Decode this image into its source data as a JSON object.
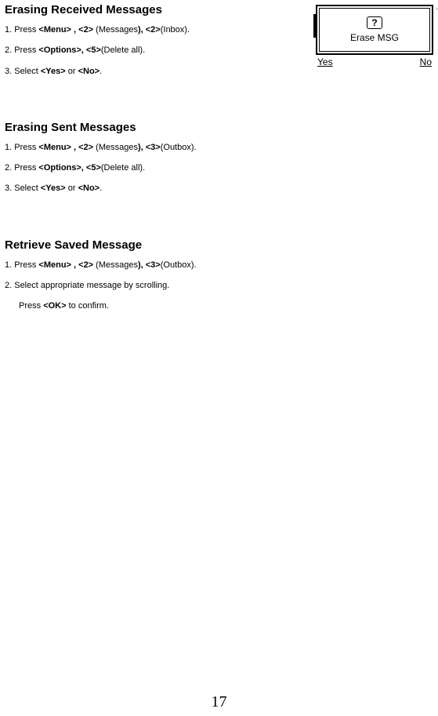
{
  "page_number": "17",
  "sections": [
    {
      "heading": "Erasing Received Messages",
      "steps": [
        {
          "prefix": "1. Press ",
          "b1": "<Menu> , <2>",
          "mid": " (Messages",
          "b2": "),  <2>",
          "suffix": "(Inbox)."
        },
        {
          "prefix": "2. Press ",
          "b1": "<Options>,  <5>",
          "mid": "",
          "b2": "",
          "suffix": "(Delete all)."
        },
        {
          "prefix": "3. Select ",
          "b1": "<Yes>",
          "mid": " or ",
          "b2": "<No>",
          "suffix": "."
        }
      ]
    },
    {
      "heading": "Erasing Sent Messages",
      "steps": [
        {
          "prefix": "1. Press ",
          "b1": "<Menu> , <2>",
          "mid": " (Messages",
          "b2": "), <3>",
          "suffix": "(Outbox)."
        },
        {
          "prefix": "2. Press ",
          "b1": "<Options>,  <5>",
          "mid": "",
          "b2": "",
          "suffix": "(Delete all)."
        },
        {
          "prefix": "3. Select ",
          "b1": "<Yes>",
          "mid": " or ",
          "b2": "<No>",
          "suffix": "."
        }
      ]
    },
    {
      "heading": "Retrieve Saved Message",
      "steps": [
        {
          "prefix": "1. Press ",
          "b1": "<Menu> , <2>",
          "mid": " (Messages",
          "b2": "), <3>",
          "suffix": "(Outbox)."
        },
        {
          "prefix": "2. Select appropriate message by scrolling.",
          "b1": "",
          "mid": "",
          "b2": "",
          "suffix": ""
        }
      ],
      "extra": {
        "prefix": "Press ",
        "b1": "<OK>",
        "suffix": " to confirm."
      }
    }
  ],
  "phone": {
    "icon": "?",
    "message": "Erase MSG",
    "softleft": "Yes",
    "softright": "No",
    "dot": "."
  }
}
